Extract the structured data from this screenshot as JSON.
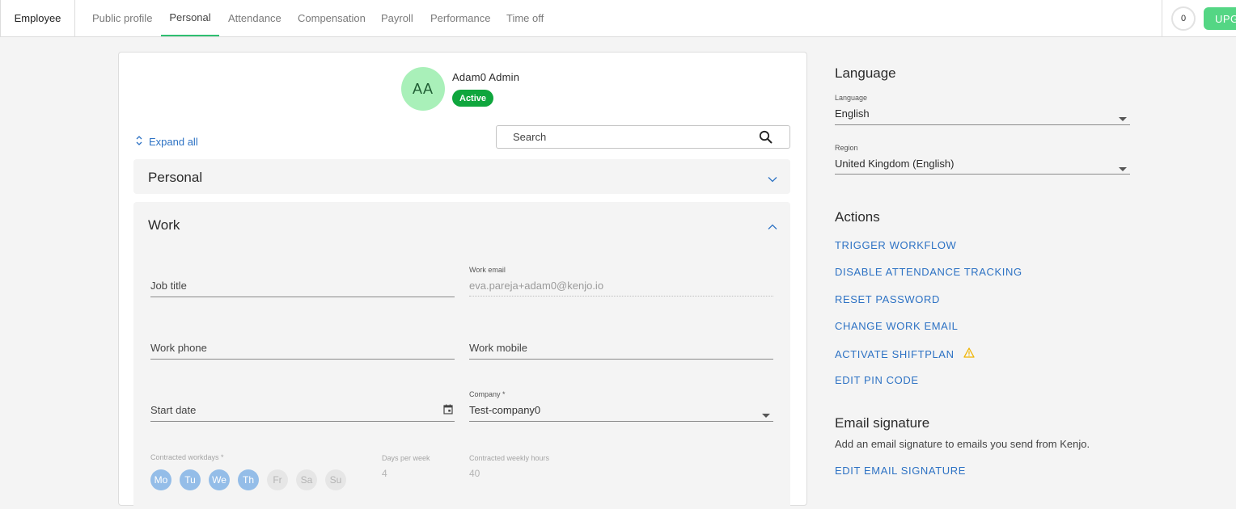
{
  "topbar": {
    "title": "Employee",
    "tabs": [
      "Public profile",
      "Personal",
      "Attendance",
      "Compensation",
      "Payroll",
      "Performance",
      "Time off"
    ],
    "active_tab": "Personal",
    "counter": "0",
    "upgrade_label": "UPG"
  },
  "profile": {
    "initials": "AA",
    "name": "Adam0 Admin",
    "status": "Active"
  },
  "toolbar": {
    "expand_all": "Expand all",
    "search_placeholder": "Search"
  },
  "sections": {
    "personal": "Personal",
    "work": "Work"
  },
  "work": {
    "job_title_placeholder": "Job title",
    "work_email_label": "Work email",
    "work_email_value": "eva.pareja+adam0@kenjo.io",
    "work_phone_placeholder": "Work phone",
    "work_mobile_placeholder": "Work mobile",
    "start_date_placeholder": "Start date",
    "company_label": "Company *",
    "company_value": "Test-company0",
    "contracted_workdays_label": "Contracted workdays *",
    "days": [
      {
        "label": "Mo",
        "selected": true
      },
      {
        "label": "Tu",
        "selected": true
      },
      {
        "label": "We",
        "selected": true
      },
      {
        "label": "Th",
        "selected": true
      },
      {
        "label": "Fr",
        "selected": false
      },
      {
        "label": "Sa",
        "selected": false
      },
      {
        "label": "Su",
        "selected": false
      }
    ],
    "days_per_week_label": "Days per week",
    "days_per_week_value": "4",
    "weekly_hours_label": "Contracted weekly hours",
    "weekly_hours_value": "40"
  },
  "language_panel": {
    "heading": "Language",
    "language_label": "Language",
    "language_value": "English",
    "region_label": "Region",
    "region_value": "United Kingdom (English)"
  },
  "actions_panel": {
    "heading": "Actions",
    "items": [
      "TRIGGER WORKFLOW",
      "DISABLE ATTENDANCE TRACKING",
      "RESET PASSWORD",
      "CHANGE WORK EMAIL",
      "ACTIVATE SHIFTPLAN",
      "EDIT PIN CODE"
    ]
  },
  "signature_panel": {
    "heading": "Email signature",
    "description": "Add an email signature to emails you send from Kenjo.",
    "edit_label": "EDIT EMAIL SIGNATURE"
  },
  "colors": {
    "accent_blue": "#2d72c4",
    "active_green": "#0fa63d",
    "upgrade_green": "#54d684",
    "warning": "#f0b400"
  }
}
